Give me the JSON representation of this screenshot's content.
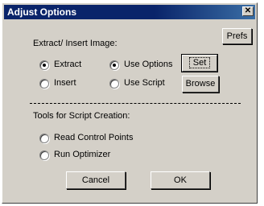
{
  "window": {
    "title": "Adjust Options",
    "close_glyph": "✕"
  },
  "buttons": {
    "prefs": "Prefs",
    "set": "Set",
    "browse": "Browse",
    "cancel": "Cancel",
    "ok": "OK"
  },
  "extract_section": {
    "heading": "Extract/ Insert Image:",
    "mode_options": [
      {
        "label": "Extract",
        "checked": true
      },
      {
        "label": "Insert",
        "checked": false
      }
    ],
    "source_options": [
      {
        "label": "Use Options",
        "checked": true
      },
      {
        "label": "Use Script",
        "checked": false
      }
    ]
  },
  "script_section": {
    "heading": "Tools for Script Creation:",
    "options": [
      {
        "label": "Read Control Points",
        "checked": false
      },
      {
        "label": "Run Optimizer",
        "checked": false
      }
    ]
  }
}
